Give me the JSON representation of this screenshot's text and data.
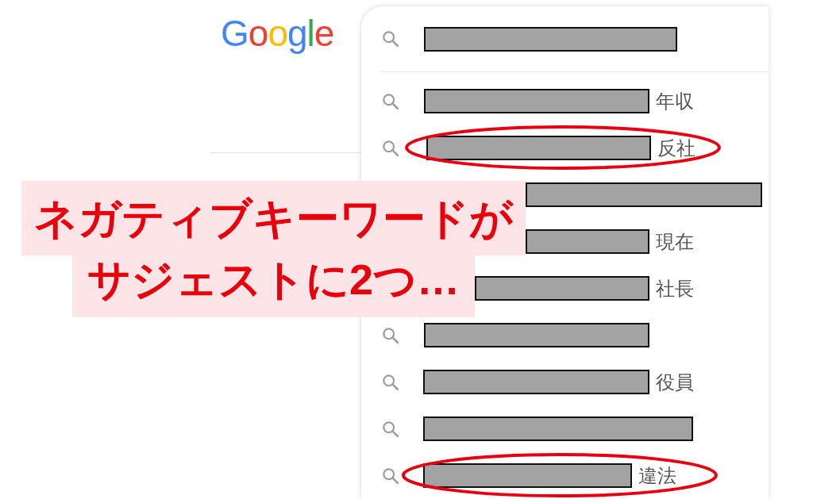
{
  "logo": {
    "text": "Google"
  },
  "search_box": {
    "redacted": true
  },
  "suggestions": [
    {
      "redacted": true,
      "suffix": "年収",
      "circled": false,
      "obscured": false
    },
    {
      "redacted": true,
      "suffix": "反社",
      "circled": true,
      "obscured": false
    },
    {
      "redacted": true,
      "circled": false,
      "obscured": true
    },
    {
      "redacted": true,
      "suffix": "現在",
      "circled": false,
      "obscured": true
    },
    {
      "redacted": true,
      "suffix": "社長",
      "circled": false,
      "obscured": true
    },
    {
      "redacted": true,
      "circled": false,
      "obscured": false
    },
    {
      "redacted": true,
      "suffix": "役員",
      "circled": false,
      "obscured": false
    },
    {
      "redacted": true,
      "circled": false,
      "obscured": false
    },
    {
      "redacted": true,
      "suffix": "違法",
      "circled": true,
      "obscured": false
    }
  ],
  "callout": {
    "lines": [
      "ネガティブキーワードが",
      "サジェストに2つ…"
    ]
  }
}
